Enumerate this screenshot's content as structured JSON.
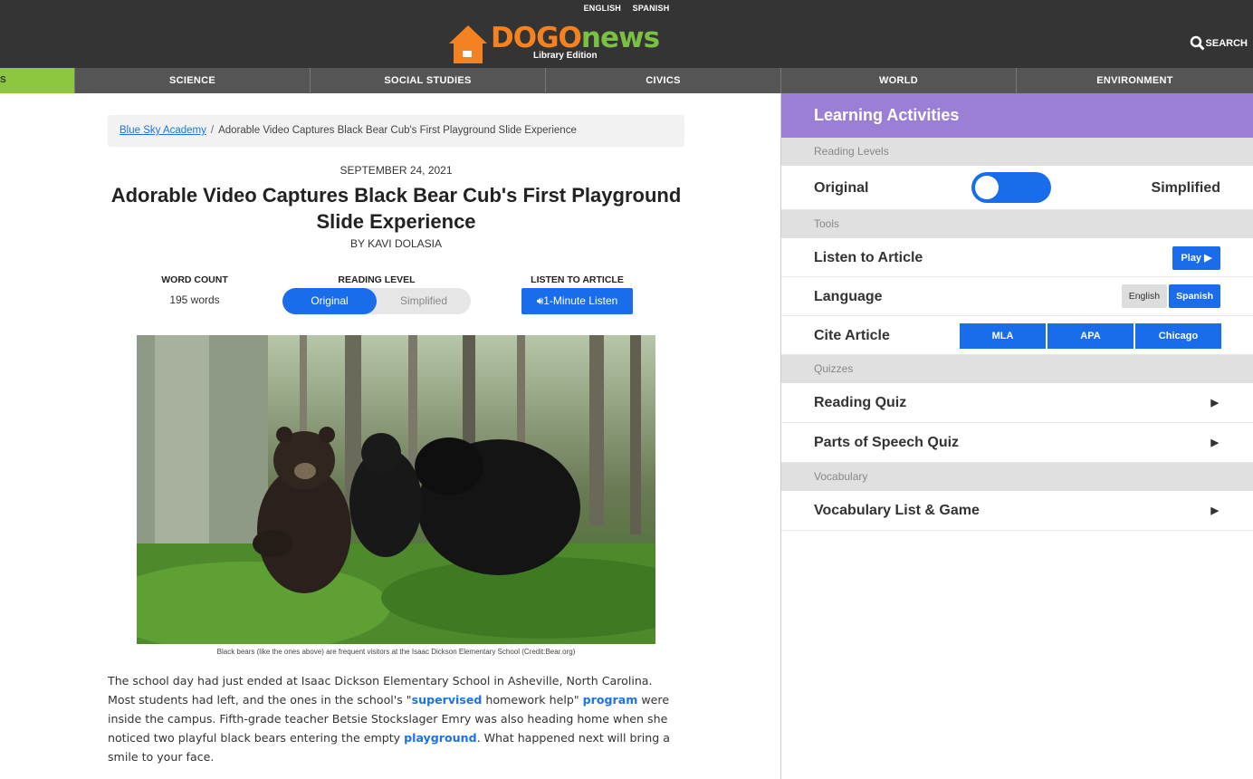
{
  "header": {
    "lang_links": [
      "ENGLISH",
      "SPANISH"
    ],
    "logo_dogo": "DOGO",
    "logo_news": "news",
    "logo_edition": "Library Edition",
    "search_label": "SEARCH"
  },
  "nav": {
    "partial": "S",
    "items": [
      "SCIENCE",
      "SOCIAL STUDIES",
      "CIVICS",
      "WORLD",
      "ENVIRONMENT"
    ]
  },
  "breadcrumb": {
    "link": "Blue Sky Academy",
    "separator": "/",
    "current": "Adorable Video Captures Black Bear Cub's First Playground Slide Experience"
  },
  "article": {
    "date": "SEPTEMBER 24, 2021",
    "title": "Adorable Video Captures Black Bear Cub's First Playground Slide Experience",
    "byline": "BY KAVI DOLASIA",
    "word_count_label": "WORD COUNT",
    "word_count_value": "195 words",
    "reading_level_label": "READING LEVEL",
    "reading_level_options": [
      "Original",
      "Simplified"
    ],
    "listen_label": "LISTEN TO ARTICLE",
    "listen_button": "1-Minute Listen",
    "caption": "Black bears (like the ones above) are frequent visitors at the Isaac Dickson Elementary School (Credit:Bear.org)",
    "body_1": "The school day had just ended at Isaac Dickson Elementary School in Asheville, North Carolina. Most students had left, and the ones in the school's \"",
    "kw_1": "supervised",
    "body_2": " homework help\" ",
    "kw_2": "program",
    "body_3": " were inside the campus. Fifth-grade teacher Betsie Stockslager Emry was also heading home when she noticed two playful black bears entering the empty ",
    "kw_3": "playground",
    "body_4": ". What happened next will bring a smile to your face."
  },
  "sidebar": {
    "title": "Learning Activities",
    "reading_levels_head": "Reading Levels",
    "original_label": "Original",
    "simplified_label": "Simplified",
    "tools_head": "Tools",
    "listen_label": "Listen to Article",
    "play_button": "Play ▶",
    "language_label": "Language",
    "language_options": [
      "English",
      "Spanish"
    ],
    "cite_label": "Cite Article",
    "cite_options": [
      "MLA",
      "APA",
      "Chicago"
    ],
    "quizzes_head": "Quizzes",
    "reading_quiz": "Reading Quiz",
    "pos_quiz": "Parts of Speech Quiz",
    "vocab_head": "Vocabulary",
    "vocab_game": "Vocabulary List & Game",
    "arrow": "▶"
  }
}
